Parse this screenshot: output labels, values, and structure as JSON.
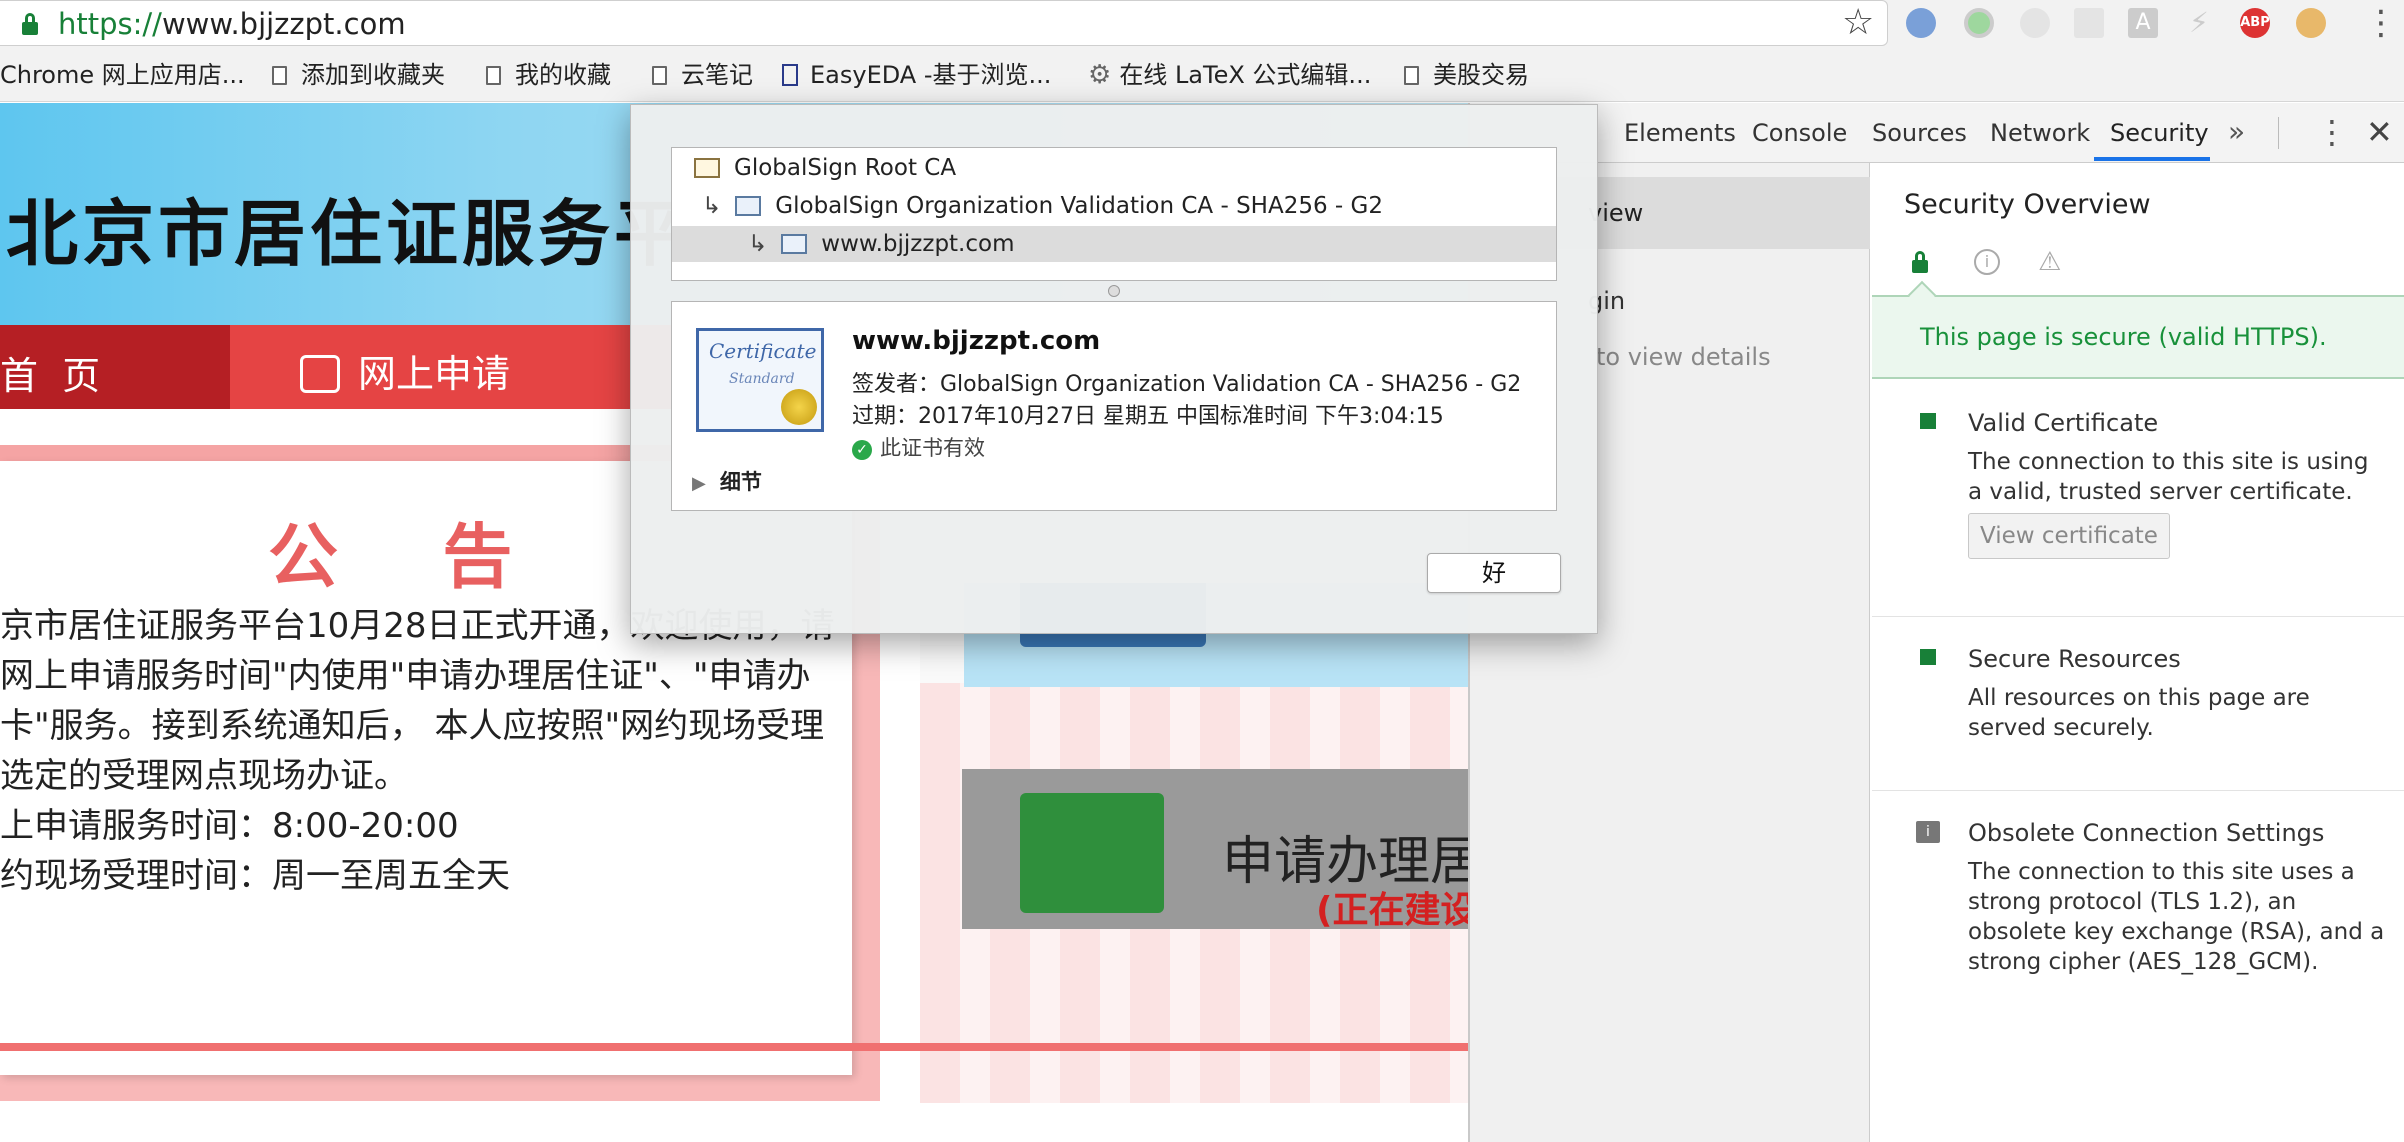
{
  "browser": {
    "url_scheme": "https://",
    "url_host": "www.bjjzzpt.com",
    "bookmarks": [
      "Chrome 网上应用店...",
      "添加到收藏夹",
      "我的收藏",
      "云笔记",
      "EasyEDA -基于浏览...",
      "在线 LaTeX 公式编辑...",
      "美股交易"
    ],
    "extensions": {
      "abp_label": "ABP",
      "gray_label": "A"
    }
  },
  "site": {
    "title": "北京市居住证服务平",
    "nav_home": "首 页",
    "nav_apply": "网上申请",
    "notice_title": "公 告",
    "notice_lines": [
      "京市居住证服务平台10月28日正式开通，欢迎使用，请",
      "网上申请服务时间\"内使用\"申请办理居住证\"、\"申请办",
      "卡\"服务。接到系统通知后， 本人应按照\"网约现场受理",
      "选定的受理网点现场办证。",
      "上申请服务时间：8:00-20:00",
      "约现场受理时间：周一至周五全天"
    ],
    "card_title": "申请办理居",
    "card_subtitle": "(正在建设"
  },
  "devtools": {
    "tabs": [
      "Elements",
      "Console",
      "Sources",
      "Network",
      "Security"
    ],
    "active_tab": "Security",
    "sidebar_items": [
      "view",
      "gin",
      "to view details"
    ],
    "overview_title": "Security Overview",
    "secure_message": "This page is secure (valid HTTPS).",
    "sections": [
      {
        "title": "Valid Certificate",
        "desc": "The connection to this site is using a valid, trusted server certificate.",
        "button": "View certificate"
      },
      {
        "title": "Secure Resources",
        "desc": "All resources on this page are served securely."
      },
      {
        "title": "Obsolete Connection Settings",
        "desc": "The connection to this site uses a strong protocol (TLS 1.2), an obsolete key exchange (RSA), and a strong cipher (AES_128_GCM)."
      }
    ],
    "accent_color": "#1a73e8",
    "secure_color": "#188038"
  },
  "cert_dialog": {
    "chain": [
      "GlobalSign Root CA",
      "GlobalSign Organization Validation CA - SHA256 - G2",
      "www.bjjzzpt.com"
    ],
    "subject": "www.bjjzzpt.com",
    "issuer_line": "签发者：GlobalSign Organization Validation CA - SHA256 - G2",
    "expiry_line": "过期：2017年10月27日 星期五 中国标准时间 下午3:04:15",
    "valid_text": "此证书有效",
    "details_label": "细节",
    "ok_label": "好",
    "cert_icon_text": "Certificate",
    "cert_icon_subtext": "Standard"
  }
}
